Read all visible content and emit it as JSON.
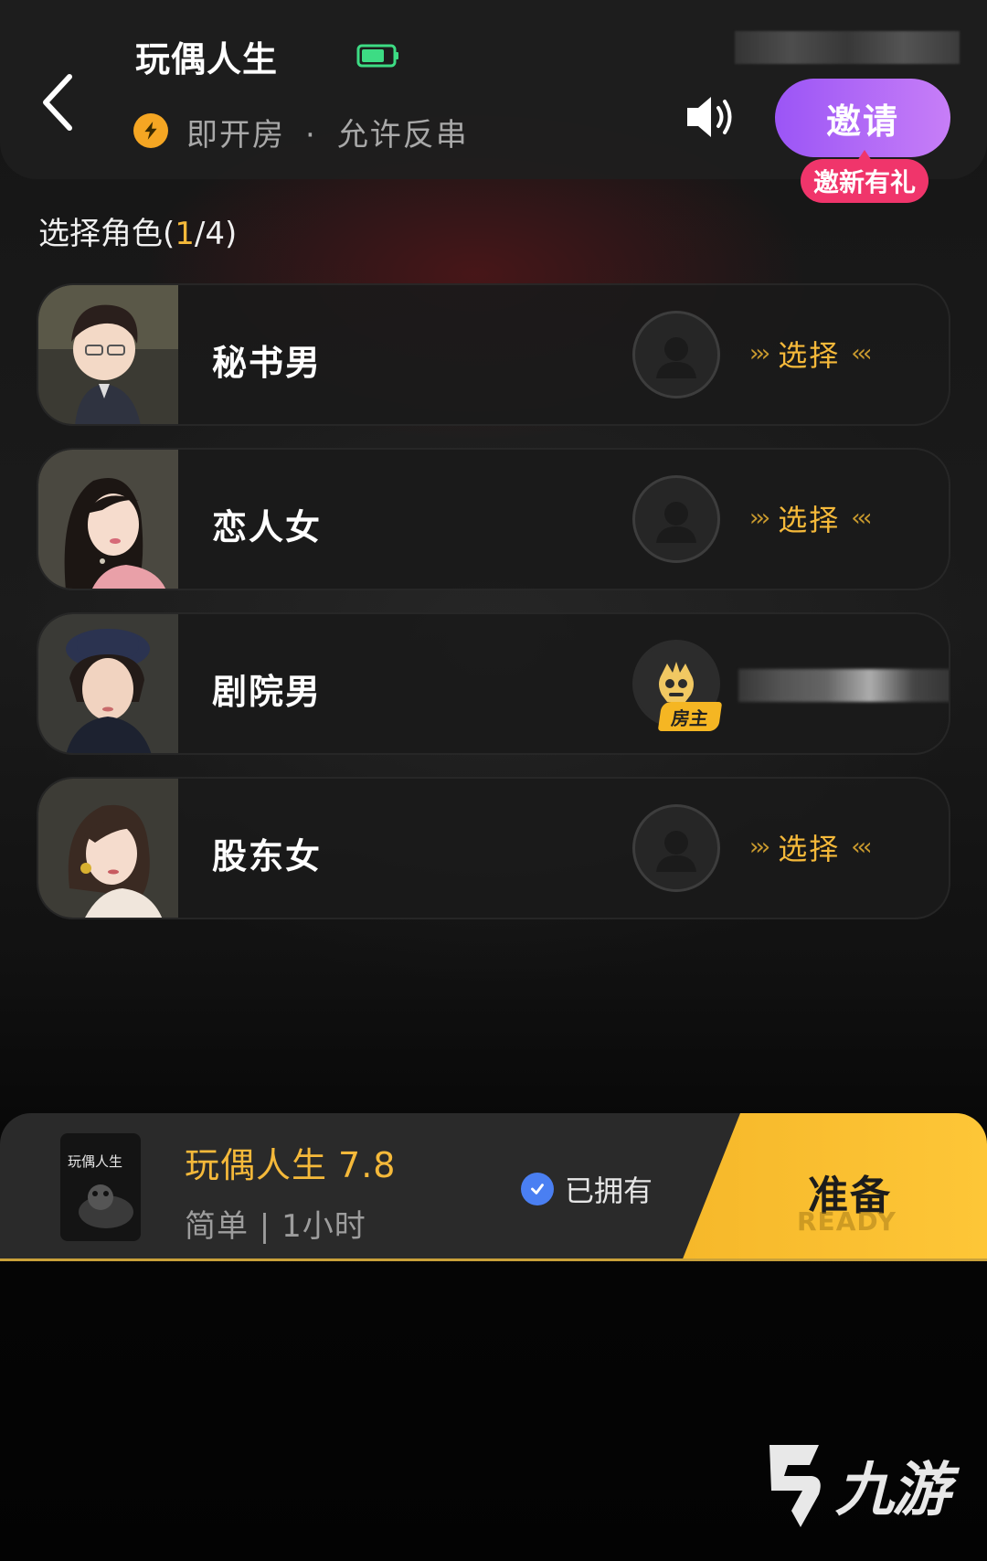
{
  "header": {
    "title": "玩偶人生",
    "room_type": "即开房",
    "separator": "·",
    "rule": "允许反串",
    "invite_label": "邀请",
    "invite_badge": "邀新有礼"
  },
  "section": {
    "prefix": "选择角色(",
    "current": "1",
    "rest": "/4)"
  },
  "roles": [
    {
      "name": "秘书男",
      "seat": "empty",
      "select_label": "选择"
    },
    {
      "name": "恋人女",
      "seat": "empty",
      "select_label": "选择"
    },
    {
      "name": "剧院男",
      "seat": "host",
      "host_label": "房主"
    },
    {
      "name": "股东女",
      "seat": "empty",
      "select_label": "选择"
    }
  ],
  "script": {
    "title": "玩偶人生",
    "score": "7.8",
    "meta": "简单 | 1小时",
    "cover_text": "玩偶人生",
    "owned_label": "已拥有"
  },
  "actions": {
    "ready_label": "准备",
    "ready_sub": "READY"
  },
  "watermark": {
    "text": "九游"
  },
  "colors": {
    "accent_gold": "#f5b93a",
    "invite_purple": "#9b55f6",
    "badge_pink": "#f0356b",
    "owned_blue": "#4a7ff2",
    "battery_green": "#3ddc84"
  },
  "icons": [
    "back-arrow-icon",
    "battery-icon",
    "lightning-icon",
    "speaker-icon",
    "person-placeholder-icon",
    "host-avatar-icon",
    "check-circle-icon",
    "watermark-logo-icon"
  ]
}
